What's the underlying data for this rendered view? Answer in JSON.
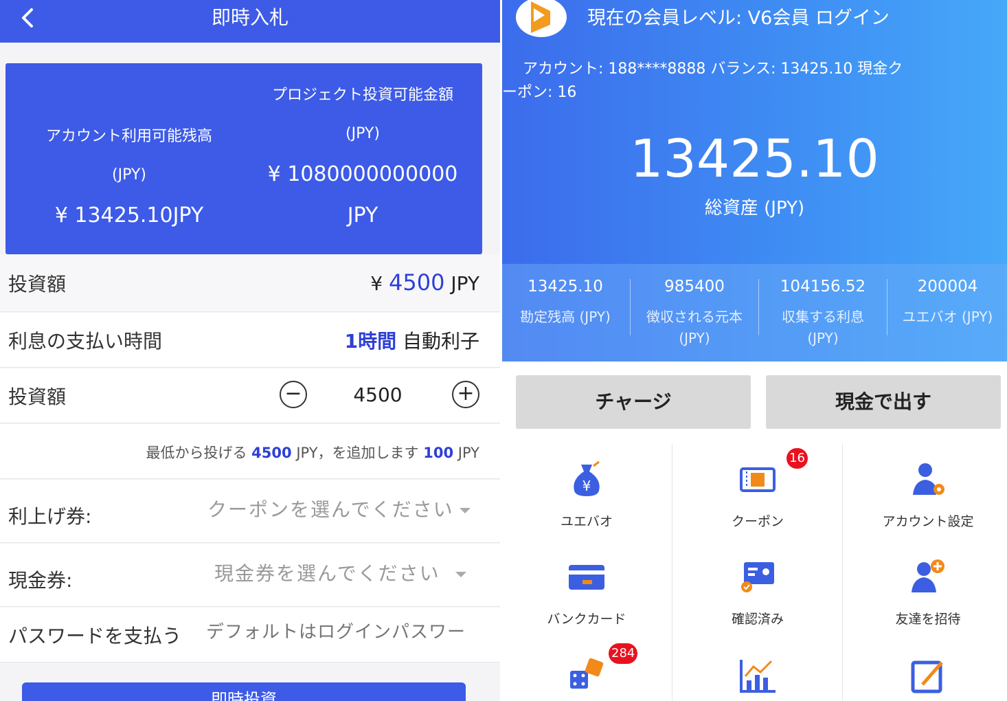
{
  "left": {
    "header": {
      "title": "即時入札"
    },
    "card": {
      "col1": {
        "label": "アカウント利用可能残高",
        "unit": "(JPY)",
        "value": "¥ 13425.10JPY"
      },
      "col2": {
        "label": "プロジェクト投資可能金額",
        "unit": "(JPY)",
        "value": "¥ 1080000000000",
        "value_unit": "JPY"
      }
    },
    "rows": {
      "amount": {
        "label": "投資額",
        "currency": "¥",
        "value": "4500",
        "unit": "JPY"
      },
      "interest": {
        "label": "利息の支払い時間",
        "value": "1時間",
        "suffix": "自動利子"
      },
      "stepper": {
        "label": "投資額",
        "minus": "−",
        "value": "4500",
        "plus": "+"
      },
      "hint": {
        "prefix": "最低から投げる",
        "min": "4500",
        "mid": "JPY，を追加します",
        "step": "100",
        "unit": "JPY"
      },
      "profit_coupon": {
        "label": "利上げ券:",
        "placeholder": "クーポンを選んでください"
      },
      "cash_coupon": {
        "label": "現金券:",
        "placeholder": "現金券を選んでください"
      },
      "password": {
        "label": "パスワードを支払う",
        "placeholder": "デフォルトはログインパスワー"
      }
    },
    "submit_label": "即時投資"
  },
  "right": {
    "level_text": "現在の会員レベル: V6会員 ログイン",
    "account_line1": "アカウント: 188****8888        バランス: 13425.10        現金ク",
    "account_line2": "ーポン: 16",
    "total": "13425.10",
    "total_label": "総資産 (JPY)",
    "stats": [
      {
        "value": "13425.10",
        "label": "勘定残高 (JPY)"
      },
      {
        "value": "985400",
        "label": "徴収される元本 (JPY)"
      },
      {
        "value": "104156.52",
        "label": "収集する利息 (JPY)"
      },
      {
        "value": "200004",
        "label": "ユエバオ (JPY)"
      }
    ],
    "buttons": {
      "charge": "チャージ",
      "withdraw": "現金で出す"
    },
    "grid": [
      {
        "label": "ユエバオ",
        "icon": "money-bag-icon"
      },
      {
        "label": "クーポン",
        "icon": "coupon-icon",
        "badge": "16"
      },
      {
        "label": "アカウント設定",
        "icon": "account-settings-icon"
      },
      {
        "label": "バンクカード",
        "icon": "bank-card-icon"
      },
      {
        "label": "確認済み",
        "icon": "verified-icon"
      },
      {
        "label": "友達を招待",
        "icon": "invite-friend-icon"
      },
      {
        "label": "",
        "icon": "dice-icon",
        "badge": "284"
      },
      {
        "label": "",
        "icon": "chart-icon"
      },
      {
        "label": "",
        "icon": "edit-icon"
      }
    ],
    "colors": {
      "primary": "#3d5be6",
      "accent_blue": "#2e3fd6",
      "badge": "#e8121f",
      "icon_blue": "#3b5fe0",
      "icon_orange": "#f28a1a"
    }
  }
}
